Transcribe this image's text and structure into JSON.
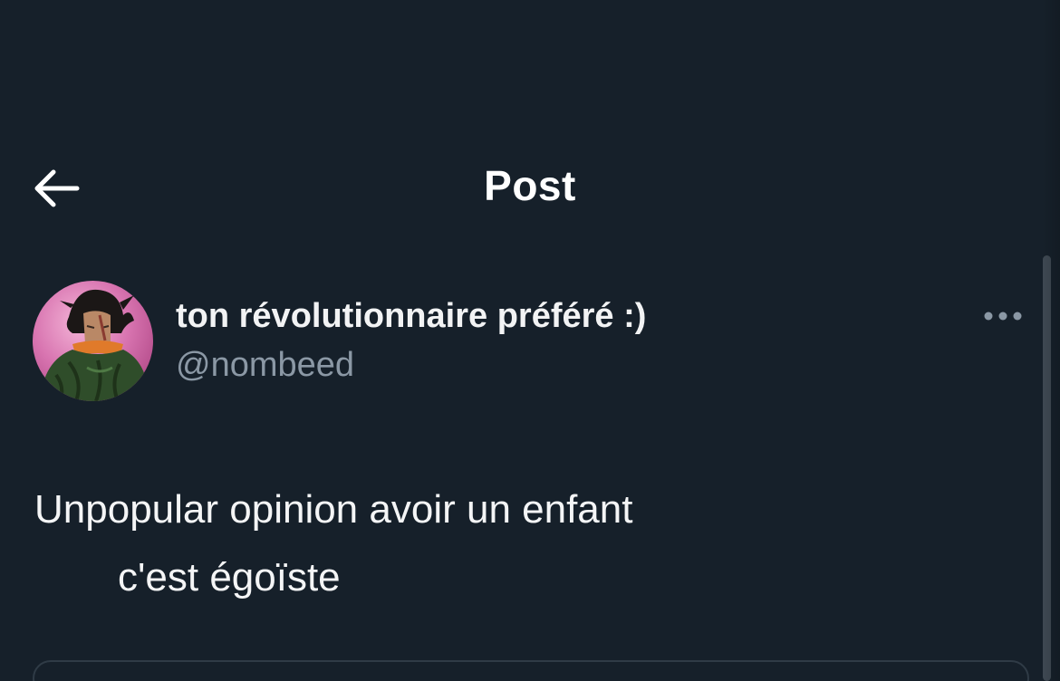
{
  "header": {
    "title": "Post",
    "back_icon": "arrow-left-icon"
  },
  "post": {
    "author": {
      "display_name": "ton révolutionnaire préféré :)",
      "handle": "@nombeed",
      "avatar_icon": "avatar"
    },
    "more_icon": "more-horizontal-icon",
    "text_lines": [
      "Unpopular opinion avoir un enfant",
      "c'est égoïste"
    ]
  },
  "colors": {
    "background": "#16202a",
    "text_primary": "#e7e9ea",
    "text_secondary": "#8b98a5",
    "title": "#ffffff"
  }
}
